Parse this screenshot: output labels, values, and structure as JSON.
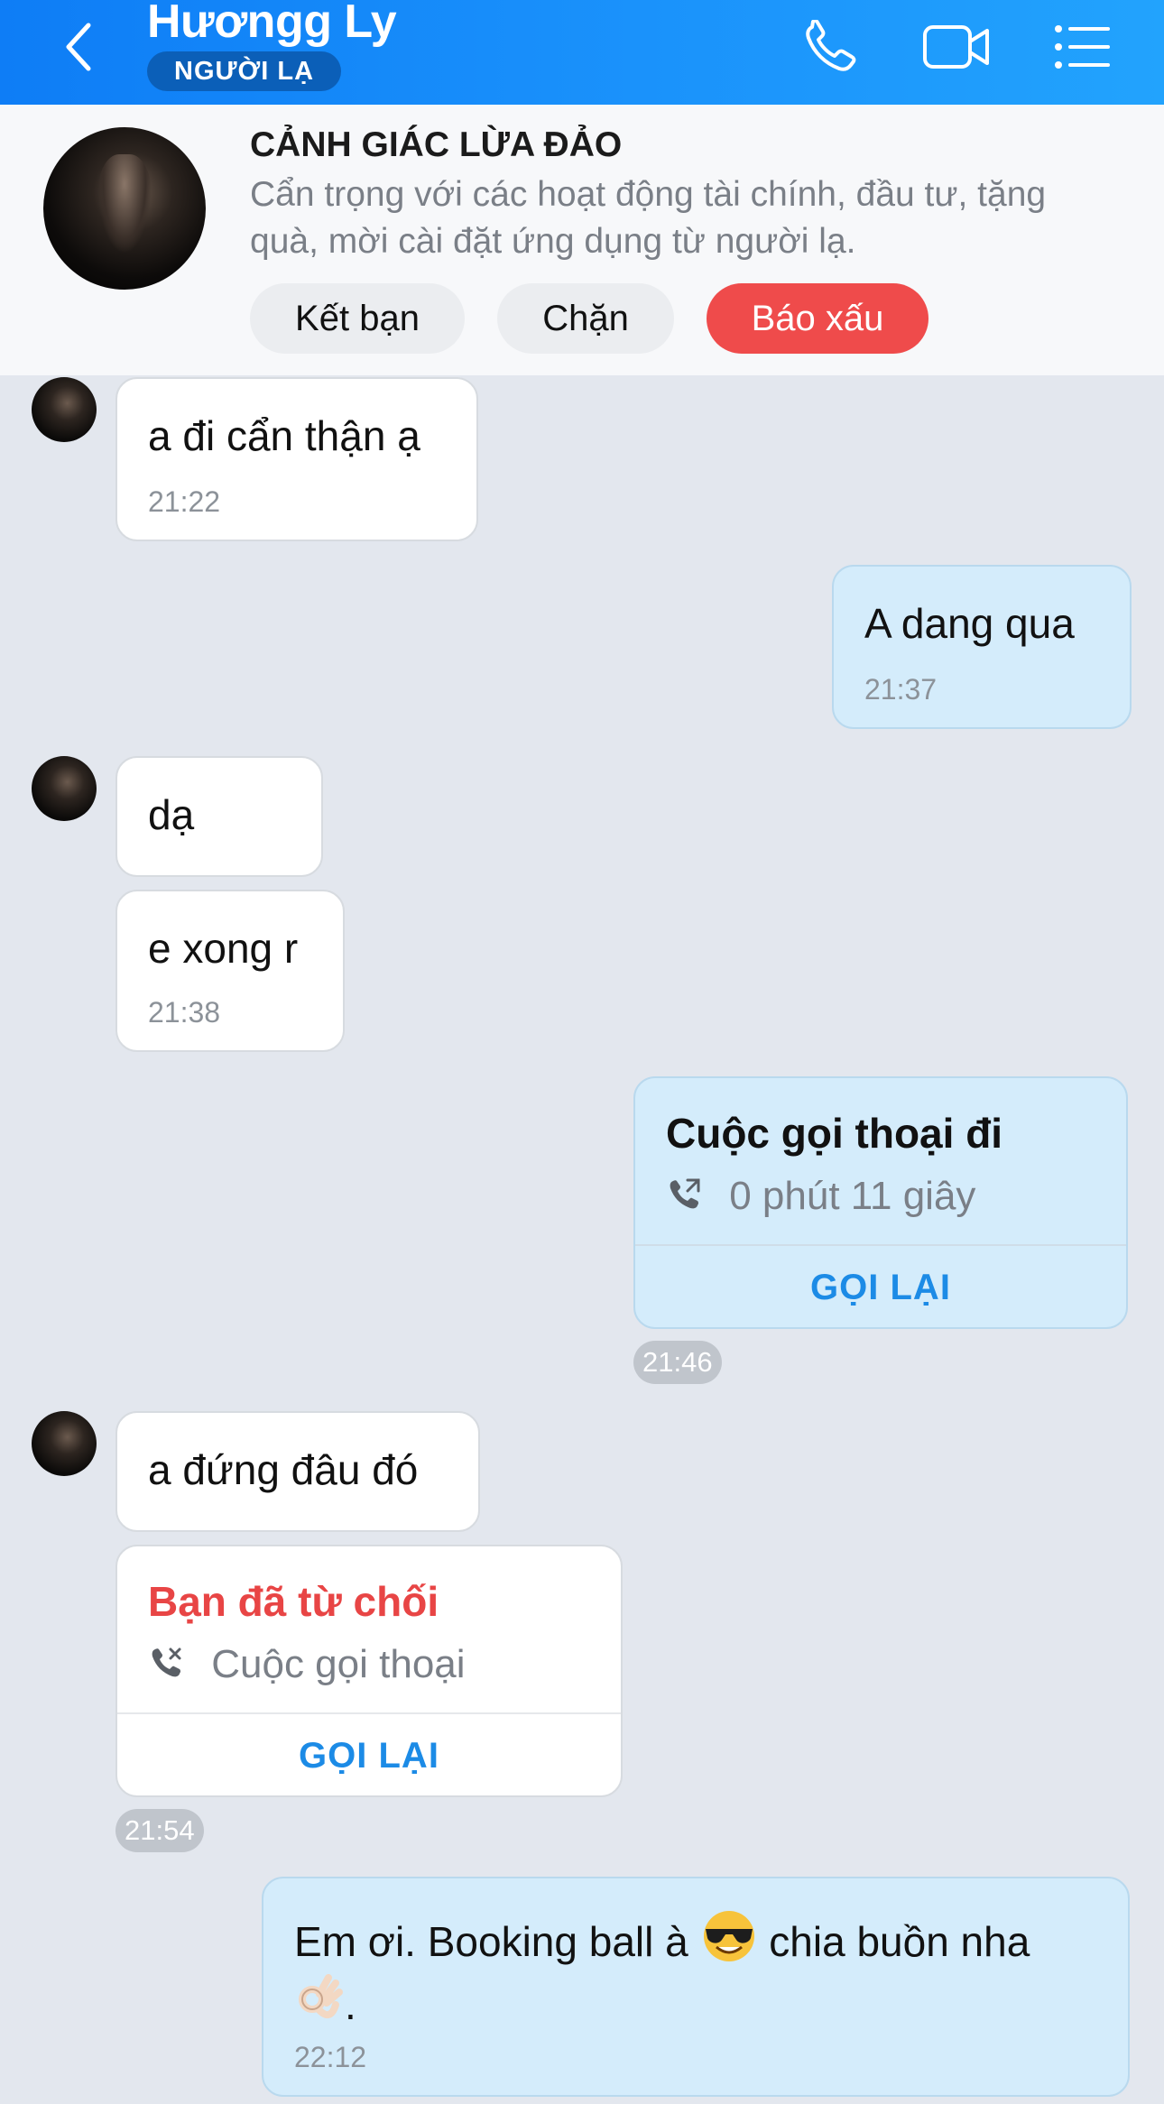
{
  "header": {
    "title": "Hươngg Ly",
    "badge": "NGƯỜI LẠ",
    "icons": [
      "back-chevron-icon",
      "phone-icon",
      "video-call-icon",
      "menu-list-icon"
    ]
  },
  "warning": {
    "title": "CẢNH GIÁC LỪA ĐẢO",
    "text": "Cẩn trọng với các hoạt động tài chính, đầu tư, tặng quà, mời cài đặt ứng dụng từ người lạ.",
    "add_friend": "Kết bạn",
    "block": "Chặn",
    "report": "Báo xấu"
  },
  "messages": {
    "m1": {
      "text": "a đi cẩn thận ạ",
      "time": "21:22"
    },
    "m2": {
      "text": "A dang qua",
      "time": "21:37"
    },
    "m3": {
      "text": "dạ"
    },
    "m4": {
      "text": "e xong r",
      "time": "21:38"
    },
    "call1": {
      "title": "Cuộc gọi thoại đi",
      "sub": "0 phút 11 giây",
      "action": "GỌI LẠI",
      "time": "21:46"
    },
    "m5": {
      "text": "a đứng đâu đó"
    },
    "call2": {
      "title": "Bạn đã từ chối",
      "sub": "Cuộc gọi thoại",
      "action": "GỌI LẠI",
      "time": "21:54"
    },
    "m6": {
      "text_a": "Em ơi. Booking ball à",
      "text_b": "chia buồn nha",
      "text_c": ".",
      "time": "22:12"
    }
  },
  "colors": {
    "header": "#1a8bf7",
    "report": "#ef4b4b",
    "sent_bubble": "#d4ecfb",
    "callback": "#1c8be6",
    "declined": "#e84545"
  }
}
